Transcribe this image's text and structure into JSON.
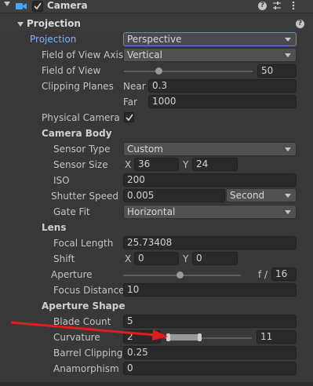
{
  "header": {
    "title": "Camera",
    "enabled": true
  },
  "projection": {
    "section_title": "Projection",
    "projection_label": "Projection",
    "projection_value": "Perspective",
    "fov_axis_label": "Field of View Axis",
    "fov_axis_value": "Vertical",
    "fov_label": "Field of View",
    "fov_value": "50",
    "fov_slider_fraction": 0.27,
    "clipping_label": "Clipping Planes",
    "near_label": "Near",
    "near_value": "0.3",
    "far_label": "Far",
    "far_value": "1000",
    "physical_label": "Physical Camera",
    "physical_checked": true
  },
  "camera_body": {
    "title": "Camera Body",
    "sensor_type_label": "Sensor Type",
    "sensor_type_value": "Custom",
    "sensor_size_label": "Sensor Size",
    "sensor_x_label": "X",
    "sensor_x_value": "36",
    "sensor_y_label": "Y",
    "sensor_y_value": "24",
    "iso_label": "ISO",
    "iso_value": "200",
    "shutter_label": "Shutter Speed",
    "shutter_value": "0.005",
    "shutter_unit": "Second",
    "gate_fit_label": "Gate Fit",
    "gate_fit_value": "Horizontal"
  },
  "lens": {
    "title": "Lens",
    "focal_label": "Focal Length",
    "focal_value": "25.73408",
    "shift_label": "Shift",
    "shift_x_label": "X",
    "shift_x_value": "0",
    "shift_y_label": "Y",
    "shift_y_value": "0",
    "aperture_label": "Aperture",
    "aperture_prefix": "f /",
    "aperture_value": "16",
    "focus_label": "Focus Distance",
    "focus_value": "10"
  },
  "aperture_shape": {
    "title": "Aperture Shape",
    "blade_label": "Blade Count",
    "blade_value": "5",
    "curvature_label": "Curvature",
    "curvature_min": "2",
    "curvature_max": "11",
    "barrel_label": "Barrel Clipping",
    "barrel_value": "0.25",
    "anamorphism_label": "Anamorphism",
    "anamorphism_value": "0"
  },
  "colors": {
    "annotation_arrow": "#e21c1c",
    "accent": "#7fb3ff"
  }
}
